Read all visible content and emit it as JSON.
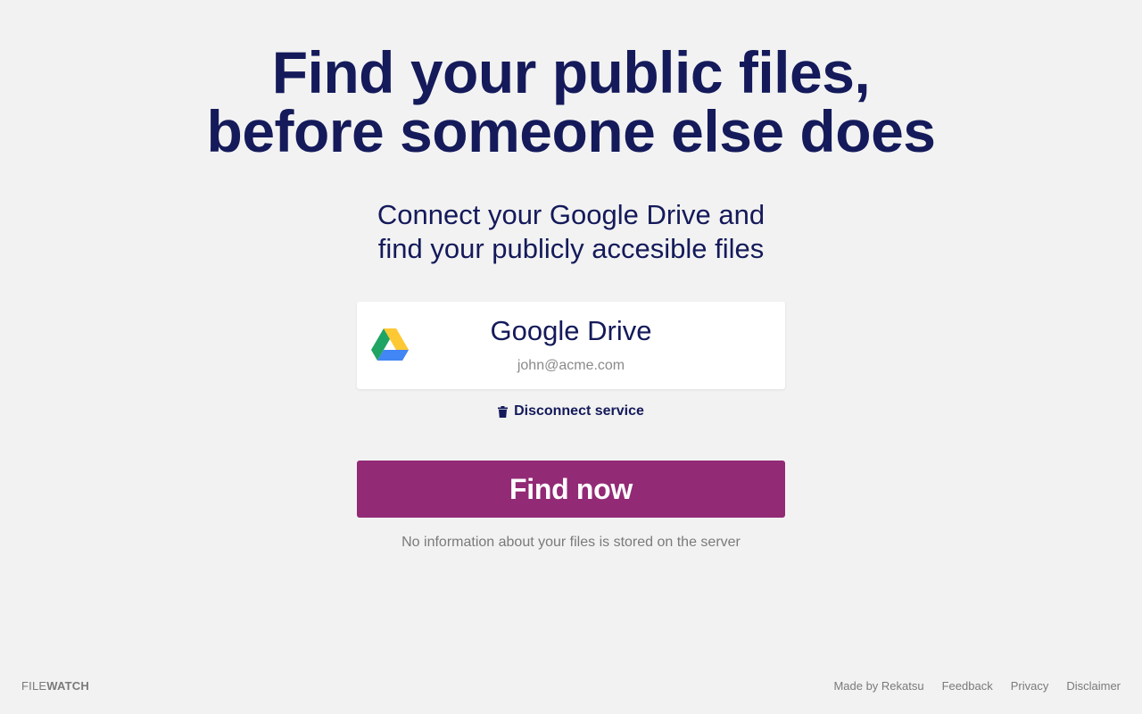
{
  "hero": {
    "title_line1": "Find your public files,",
    "title_line2": "before someone else does"
  },
  "subtitle": {
    "line1": "Connect your Google Drive and",
    "line2": "find your publicly accesible files"
  },
  "service": {
    "name": "Google Drive",
    "account": "john@acme.com",
    "icon": "google-drive-icon"
  },
  "disconnect": {
    "label": "Disconnect service",
    "icon": "trash-icon"
  },
  "find_button": {
    "label": "Find now",
    "color": "#922a75"
  },
  "privacy_note": "No information about your files is stored on the server",
  "footer": {
    "brand_light": "FILE",
    "brand_bold": "WATCH",
    "links": [
      "Made by Rekatsu",
      "Feedback",
      "Privacy",
      "Disclaimer"
    ]
  },
  "colors": {
    "background": "#f2f2f2",
    "heading": "#141a5a",
    "accent": "#922a75",
    "muted": "#7a7a7a"
  }
}
